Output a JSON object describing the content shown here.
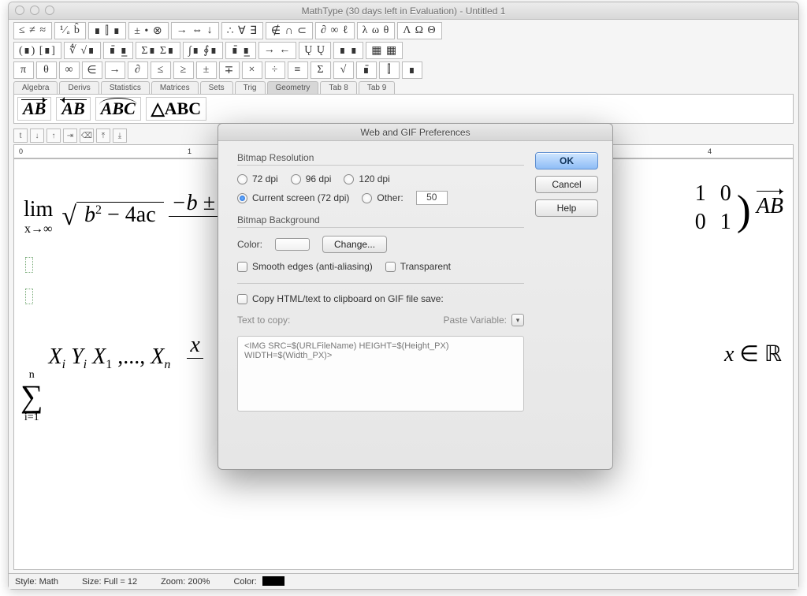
{
  "window": {
    "title": "MathType (30 days left in Evaluation) - Untitled 1"
  },
  "toolbar": {
    "row1": [
      "≤ ≠ ≈",
      "¹⁄ₐ b̂",
      "∎ ⫿ ∎",
      "± • ⊗",
      "→ ⇔ ↓",
      "∴ ∀ ∃",
      "∉ ∩ ⊂",
      "∂ ∞ ℓ",
      "λ ω θ",
      "Λ Ω Θ"
    ],
    "row2": [
      "(∎) [∎]",
      "∜ √∎",
      "∎̄ ∎̲",
      "Σ∎ Σ∎",
      "∫∎ ∮∎",
      "∎̄ ∎̲",
      "→ ←",
      "Ų Ų",
      "∎ ∎",
      "▦ ▦"
    ],
    "row3": [
      "π",
      "θ",
      "∞",
      "∈",
      "→",
      "∂",
      "≤",
      "≥",
      "±",
      "∓",
      "×",
      "÷",
      "≡",
      "Σ",
      "√",
      "∎̄",
      "⫿",
      "∎"
    ]
  },
  "categories": [
    "Algebra",
    "Derivs",
    "Statistics",
    "Matrices",
    "Sets",
    "Trig",
    "Geometry",
    "Tab 8",
    "Tab 9"
  ],
  "active_category": "Geometry",
  "palette": {
    "ab1": "AB",
    "ab2": "AB",
    "abc": "ABC",
    "dabc": "△ABC"
  },
  "ruler_numbers": [
    "0",
    "1",
    "4"
  ],
  "status": {
    "style_label": "Style:",
    "style_value": "Math",
    "size_label": "Size:",
    "size_value": "Full = 12",
    "zoom_label": "Zoom:",
    "zoom_value": "200%",
    "color_label": "Color:"
  },
  "doc": {
    "lim": "lim",
    "xto": "x→∞",
    "b2": "b",
    "sq": "2",
    "m4ac": "− 4ac",
    "frac_top": "−b ±",
    "frac_bot": " ",
    "mat": [
      "1",
      "0",
      "0",
      "1"
    ],
    "AB": "AB",
    "sum_top": "n",
    "sum_bot": "i=1",
    "series": "X",
    "i": "i",
    "Y": "Y",
    "X1": "X",
    "one": "1",
    "dots": ",...,",
    "Xn": "X",
    "nn": "n",
    "x_frac": "x",
    "xinR_x": "x",
    "in": "∈",
    "R": "R"
  },
  "dialog": {
    "title": "Web and GIF Preferences",
    "ok": "OK",
    "cancel": "Cancel",
    "help": "Help",
    "grp_res": "Bitmap Resolution",
    "dpi72": "72 dpi",
    "dpi96": "96 dpi",
    "dpi120": "120 dpi",
    "dpi_cur": "Current screen (72 dpi)",
    "dpi_other": "Other:",
    "dpi_other_val": "50",
    "grp_bg": "Bitmap Background",
    "color_label": "Color:",
    "change": "Change...",
    "smooth": "Smooth edges (anti-aliasing)",
    "transparent": "Transparent",
    "copy_chk": "Copy HTML/text to clipboard on GIF file save:",
    "text_to_copy": "Text to copy:",
    "paste_var": "Paste Variable:",
    "textarea": "<IMG SRC=$(URLFileName) HEIGHT=$(Height_PX) WIDTH=$(Width_PX)>"
  }
}
